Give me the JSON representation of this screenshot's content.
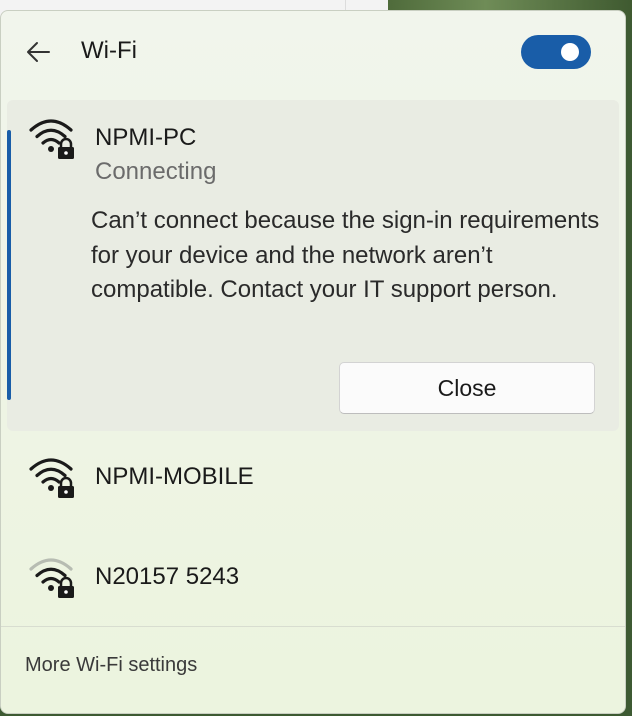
{
  "header": {
    "title": "Wi-Fi",
    "toggle_state": "on"
  },
  "networks": [
    {
      "name": "NPMI-PC",
      "status": "Connecting",
      "message": "Can’t connect because the sign-in requirements for your device and the network aren’t compatible. Contact your IT support person.",
      "close_label": "Close",
      "icon": "wifi-secured-icon"
    },
    {
      "name": "NPMI-MOBILE",
      "icon": "wifi-secured-icon"
    },
    {
      "name": "N20157 5243",
      "icon": "wifi-secured-weak-icon"
    }
  ],
  "footer": {
    "link_label": "More Wi-Fi settings"
  },
  "colors": {
    "accent": "#195da8",
    "panel": "#eef4e4"
  }
}
